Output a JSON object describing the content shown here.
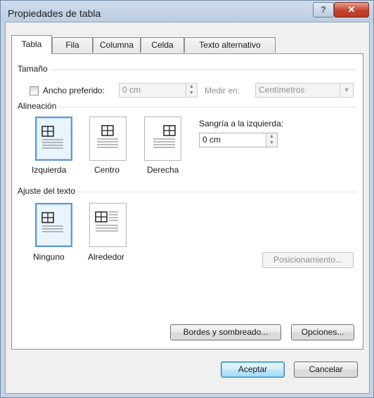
{
  "window": {
    "title": "Propiedades de tabla",
    "help_label": "?",
    "close_label": "✕"
  },
  "tabs": [
    {
      "label": "Tabla",
      "active": true
    },
    {
      "label": "Fila",
      "active": false
    },
    {
      "label": "Columna",
      "active": false
    },
    {
      "label": "Celda",
      "active": false
    },
    {
      "label": "Texto alternativo",
      "active": false
    }
  ],
  "size": {
    "group_label": "Tamaño",
    "preferred_width_label": "Ancho preferido:",
    "preferred_width_checked": false,
    "width_value": "0 cm",
    "measure_label": "Medir en:",
    "measure_value": "Centímetros"
  },
  "alignment": {
    "group_label": "Alineación",
    "options": [
      {
        "label": "Izquierda",
        "selected": true,
        "icon": "align-left-icon"
      },
      {
        "label": "Centro",
        "selected": false,
        "icon": "align-center-icon"
      },
      {
        "label": "Derecha",
        "selected": false,
        "icon": "align-right-icon"
      }
    ],
    "indent_label": "Sangría a la izquierda:",
    "indent_value": "0 cm"
  },
  "wrapping": {
    "group_label": "Ajuste del texto",
    "options": [
      {
        "label": "Ninguno",
        "selected": true,
        "icon": "wrap-none-icon"
      },
      {
        "label": "Alrededor",
        "selected": false,
        "icon": "wrap-around-icon"
      }
    ],
    "positioning_label": "Posicionamiento..."
  },
  "buttons": {
    "borders_label": "Bordes y sombreado...",
    "options_label": "Opciones...",
    "ok_label": "Aceptar",
    "cancel_label": "Cancelar"
  },
  "colors": {
    "selection_border": "#5d9ad8",
    "close_button": "#c4432c"
  }
}
